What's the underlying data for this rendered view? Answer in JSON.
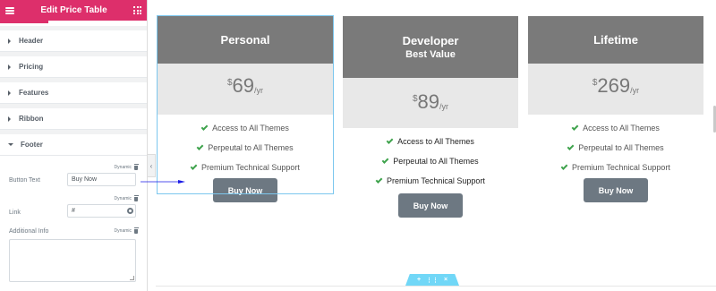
{
  "panel": {
    "title": "Edit Price Table",
    "sections": [
      {
        "label": "Header"
      },
      {
        "label": "Pricing"
      },
      {
        "label": "Features"
      },
      {
        "label": "Ribbon"
      },
      {
        "label": "Footer"
      }
    ],
    "footer": {
      "dynamic_label": "Dynamic",
      "button_text_label": "Button Text",
      "button_text_value": "Buy Now",
      "link_label": "Link",
      "link_value": "#",
      "additional_info_label": "Additional Info"
    }
  },
  "colors": {
    "accent": "#dd2f6b",
    "header_gray": "#7a7a7a",
    "button_gray": "#6d7882",
    "check_green": "#3fa34d",
    "selection_blue": "#7cc7ee"
  },
  "cards": [
    {
      "title": "Personal",
      "currency": "$",
      "price": "69",
      "period": "/yr",
      "features": [
        "Access to All Themes",
        "Perpeutal to All Themes",
        "Premium Technical Support"
      ],
      "button": "Buy Now"
    },
    {
      "title": "Developer",
      "subtitle": "Best Value",
      "currency": "$",
      "price": "89",
      "period": "/yr",
      "features": [
        "Access to All Themes",
        "Perpeutal to All Themes",
        "Premium Technical Support"
      ],
      "button": "Buy Now"
    },
    {
      "title": "Lifetime",
      "currency": "$",
      "price": "269",
      "period": "/yr",
      "features": [
        "Access to All Themes",
        "Perpeutal to All Themes",
        "Premium Technical Support"
      ],
      "button": "Buy Now"
    }
  ]
}
